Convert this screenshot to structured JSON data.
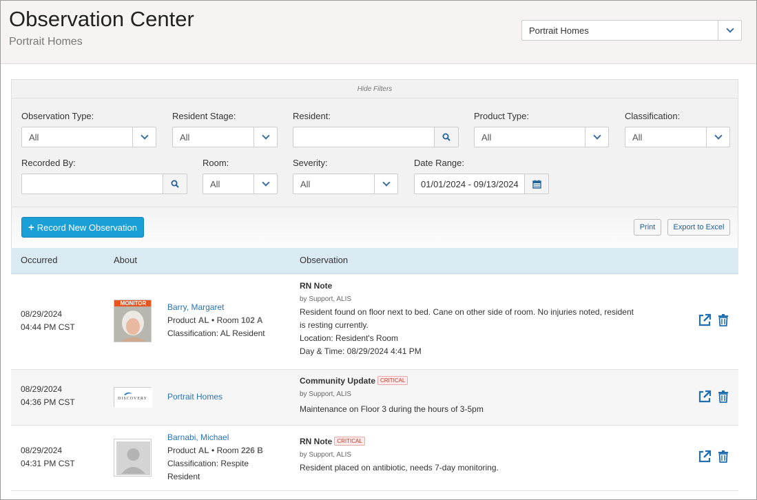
{
  "header": {
    "title": "Observation Center",
    "subtitle": "Portrait Homes",
    "community_select": "Portrait Homes"
  },
  "filters": {
    "hide_label": "Hide Filters",
    "observation_type": {
      "label": "Observation Type:",
      "value": "All"
    },
    "resident_stage": {
      "label": "Resident Stage:",
      "value": "All"
    },
    "resident": {
      "label": "Resident:",
      "value": ""
    },
    "product_type": {
      "label": "Product Type:",
      "value": "All"
    },
    "classification": {
      "label": "Classification:",
      "value": "All"
    },
    "recorded_by": {
      "label": "Recorded By:",
      "value": ""
    },
    "room": {
      "label": "Room:",
      "value": "All"
    },
    "severity": {
      "label": "Severity:",
      "value": "All"
    },
    "date_range": {
      "label": "Date Range:",
      "value": "01/01/2024 - 09/13/2024"
    }
  },
  "toolbar": {
    "record_label": "Record New Observation",
    "print_label": "Print",
    "export_label": "Export to Excel"
  },
  "table": {
    "columns": [
      "Occurred",
      "About",
      "Observation"
    ],
    "rows": [
      {
        "date": "08/29/2024",
        "time": "04:44 PM CST",
        "photo_badge": "MONITOR",
        "name": "Barry, Margaret",
        "product_prefix": "Product",
        "product": "AL",
        "room_prefix": "• Room",
        "room": "102 A",
        "classification": "Classification: AL Resident",
        "title": "RN Note",
        "by": "by Support, ALIS",
        "text_1": "Resident found on floor next to bed. Cane on other side of room. No injuries noted, resident",
        "text_2": "is resting currently.",
        "location": "Location: Resident's Room",
        "datetime": "Day & Time: 08/29/2024 4:41 PM"
      },
      {
        "date": "08/29/2024",
        "time": "04:36 PM CST",
        "logo_text": "DISCOVERY",
        "name": "Portrait Homes",
        "title": "Community Update",
        "badge": "CRITICAL",
        "by": "by Support, ALIS",
        "text_1": "Maintenance on Floor 3 during the hours of 3-5pm"
      },
      {
        "date": "08/29/2024",
        "time": "04:31 PM CST",
        "name": "Barnabi, Michael",
        "product_prefix": "Product",
        "product": "AL",
        "room_prefix": "• Room",
        "room": "226 B",
        "classification_1": "Classification: Respite",
        "classification_2": "Resident",
        "title": "RN Note",
        "badge": "CRITICAL",
        "by": "by Support, ALIS",
        "text_1": "Resident placed on antibiotic, needs 7-day monitoring."
      }
    ]
  },
  "colors": {
    "accent": "#1a9fd6",
    "link": "#2a73b3",
    "table_header": "#daeaf3",
    "critical": "#c0392b"
  }
}
